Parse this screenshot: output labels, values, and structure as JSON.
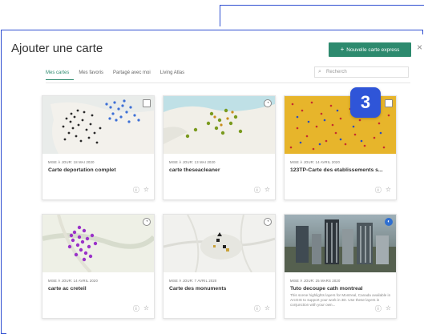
{
  "dialog": {
    "title": "Ajouter une carte",
    "new_button": "Nouvelle carte express",
    "close": "×"
  },
  "tabs": [
    "Mes cartes",
    "Mes favoris",
    "Partagé avec moi",
    "Living Atlas"
  ],
  "search": {
    "placeholder": "Recherch"
  },
  "step_badge": "3",
  "cards": [
    {
      "date": "MISE À JOUR: 18 MAI 2020",
      "title": "Carte deportation complet",
      "description": ""
    },
    {
      "date": "MISE À JOUR: 13 MAI 2020",
      "title": "carte theseacleaner",
      "description": ""
    },
    {
      "date": "MISE À JOUR: 14 AVRIL 2020",
      "title": "123TP-Carte des etablissements s...",
      "description": ""
    },
    {
      "date": "MISE À JOUR: 14 AVRIL 2020",
      "title": "carte ac creteil",
      "description": ""
    },
    {
      "date": "MISE À JOUR: 7 AVRIL 2020",
      "title": "Carte des monuments",
      "description": ""
    },
    {
      "date": "MISE À JOUR: 25 MARS 2020",
      "title": "Tuto decoupe cath montreal",
      "description": "This scene highlights layers for Montreal, Canada available in ArcGIS to support your work in 3D. Use these layers in conjunction with your own..."
    }
  ],
  "icons": {
    "info": "info-icon",
    "favorite": "star-icon",
    "map_type": "map-type-icon"
  },
  "colors": {
    "accent": "#2d8a6e",
    "badge": "#2f55d8",
    "frame": "#2f4fd1"
  }
}
